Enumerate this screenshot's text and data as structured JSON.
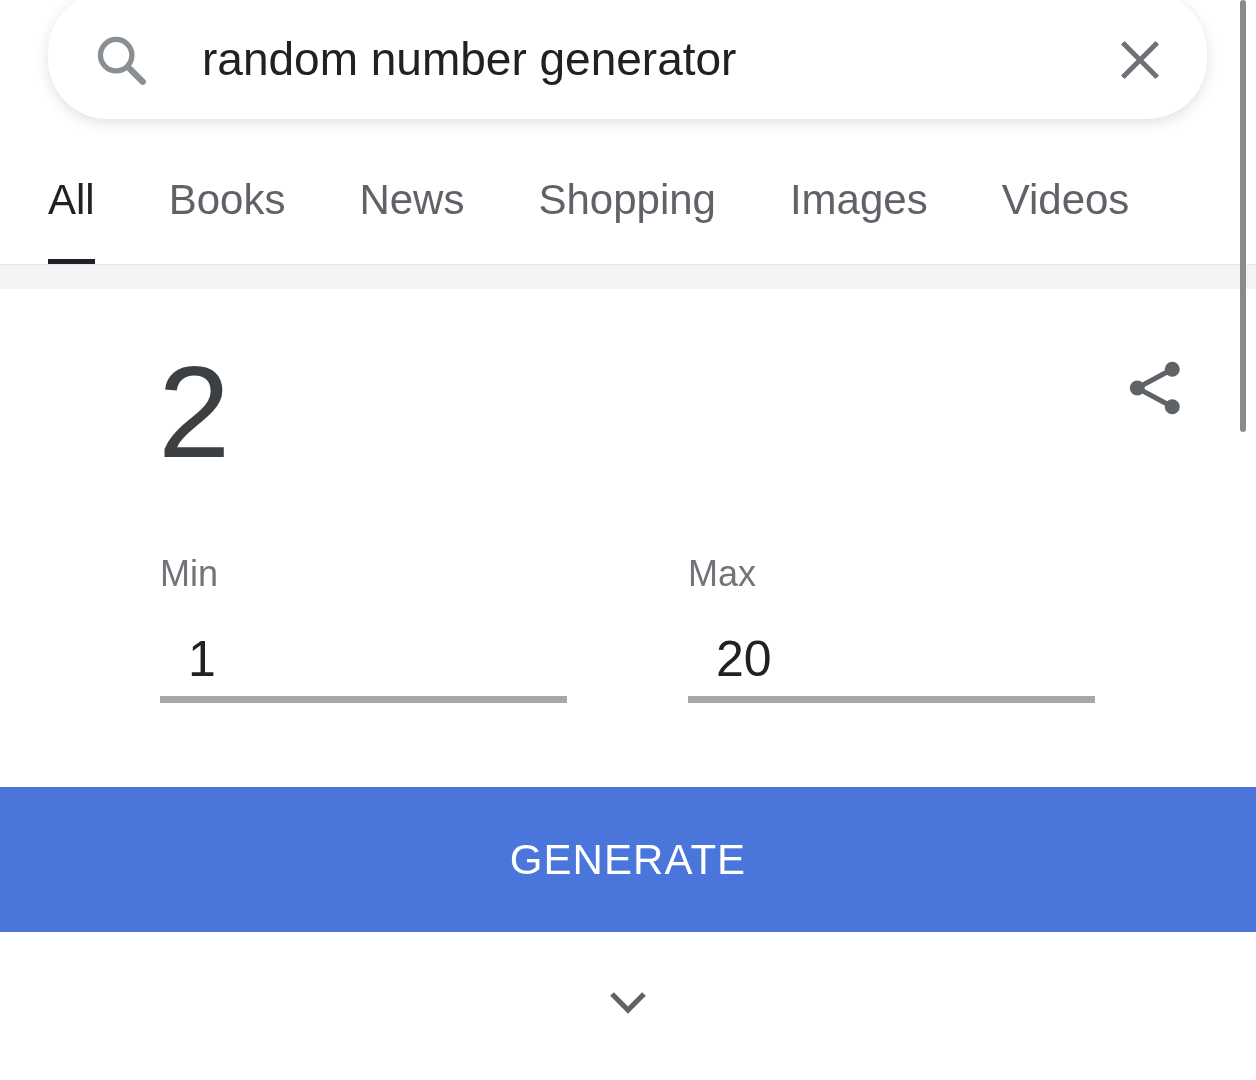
{
  "search": {
    "value": "random number generator"
  },
  "tabs": [
    {
      "label": "All",
      "selected": true
    },
    {
      "label": "Books",
      "selected": false
    },
    {
      "label": "News",
      "selected": false
    },
    {
      "label": "Shopping",
      "selected": false
    },
    {
      "label": "Images",
      "selected": false
    },
    {
      "label": "Videos",
      "selected": false
    }
  ],
  "result": "2",
  "fields": [
    {
      "label": "Min",
      "value": "1"
    },
    {
      "label": "Max",
      "value": "20"
    }
  ],
  "button": "GENERATE"
}
